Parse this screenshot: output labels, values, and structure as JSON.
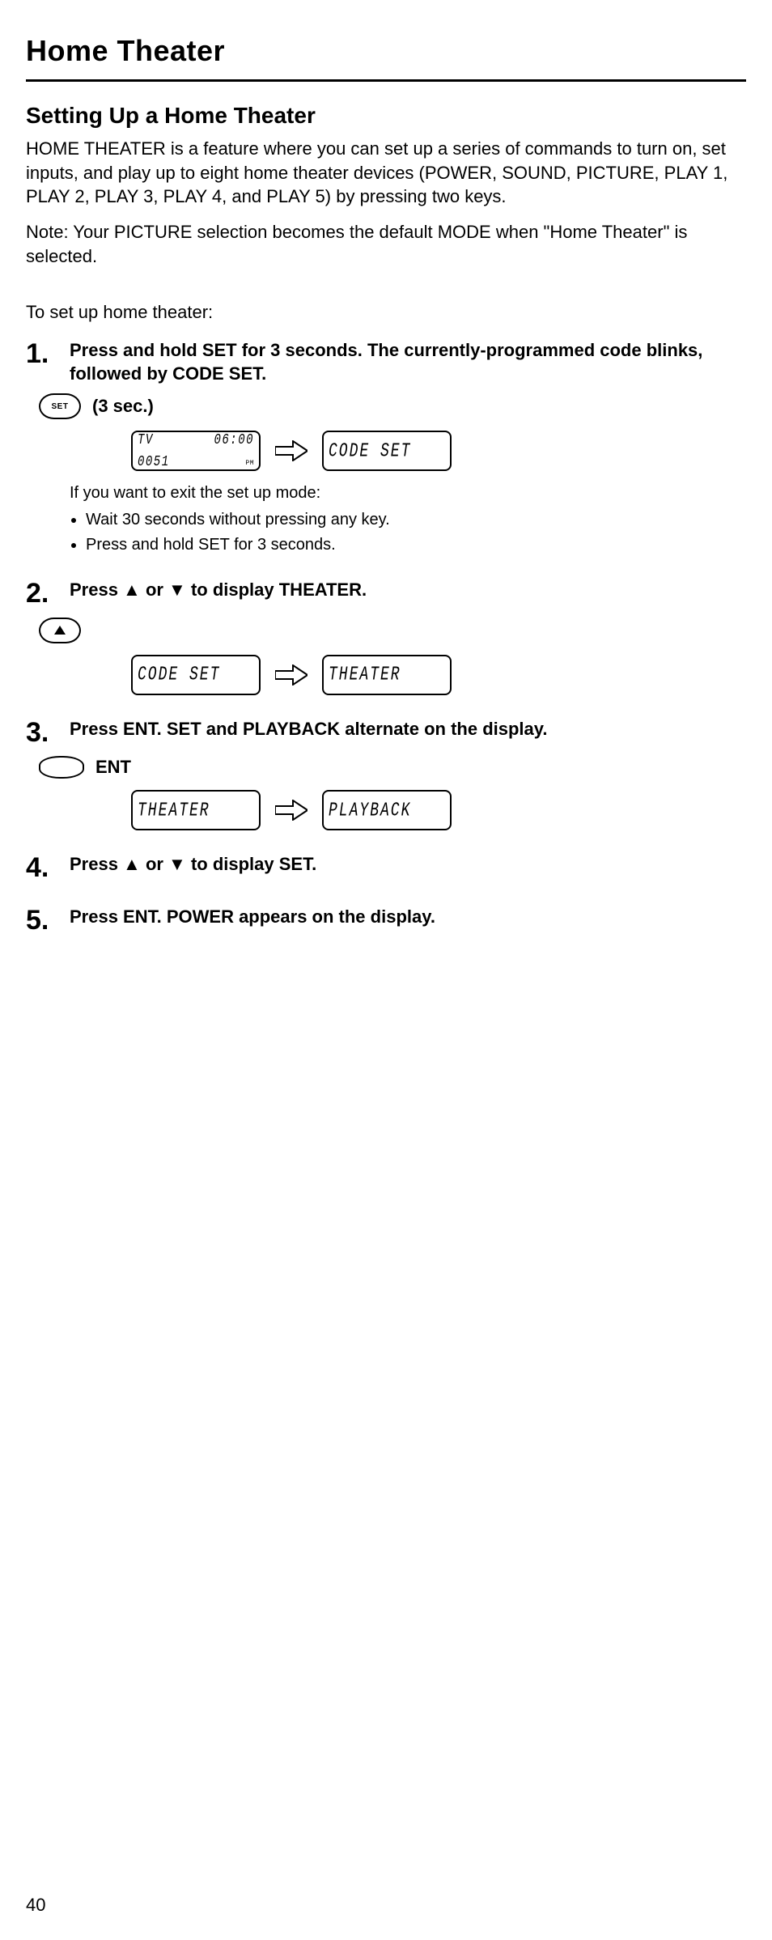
{
  "title": "Home Theater",
  "section1": {
    "heading": "Setting Up a Home Theater",
    "intro": "HOME THEATER is a feature where you can set up a series of commands to turn on, set inputs, and play up to eight home theater devices (POWER, SOUND, PICTURE, PLAY 1, PLAY 2, PLAY 3, PLAY 4, and PLAY 5) by pressing two keys.",
    "note": "Note: Your PICTURE selection becomes the default MODE when \"Home Theater\" is selected."
  },
  "stepsTitle": "To set up home theater:",
  "stepA": {
    "num": "1.",
    "text": "Press and hold SET for 3 seconds. The currently-programmed code blinks, followed by CODE SET.",
    "btnLabel": "SET",
    "iconCaption": "(3 sec.)",
    "lcdA_top_left": "TV",
    "lcdA_top_right": "06:00",
    "lcdA_bot_left": "0051",
    "lcdA_bot_right": "PM",
    "lcdB": "CODE SET",
    "hint_label": "If you want to exit the set up mode:",
    "hint_items": [
      "Wait 30 seconds without pressing any key.",
      "Press and hold SET for 3 seconds."
    ]
  },
  "stepB": {
    "num": "2.",
    "text": "Press ▲ or ▼ to display THEATER.",
    "lcdA": "CODE SET",
    "lcdB": "THEATER"
  },
  "stepC": {
    "num": "3.",
    "text": "Press ENT. SET and PLAYBACK alternate on the display.",
    "btnLabel": "ENT",
    "lcdA": "THEATER",
    "lcdB": "PLAYBACK"
  },
  "stepD": {
    "num": "4.",
    "text": "Press ▲ or ▼ to display SET."
  },
  "stepE": {
    "num": "5.",
    "text": "Press ENT. POWER appears on the display."
  },
  "pagenum": "40"
}
